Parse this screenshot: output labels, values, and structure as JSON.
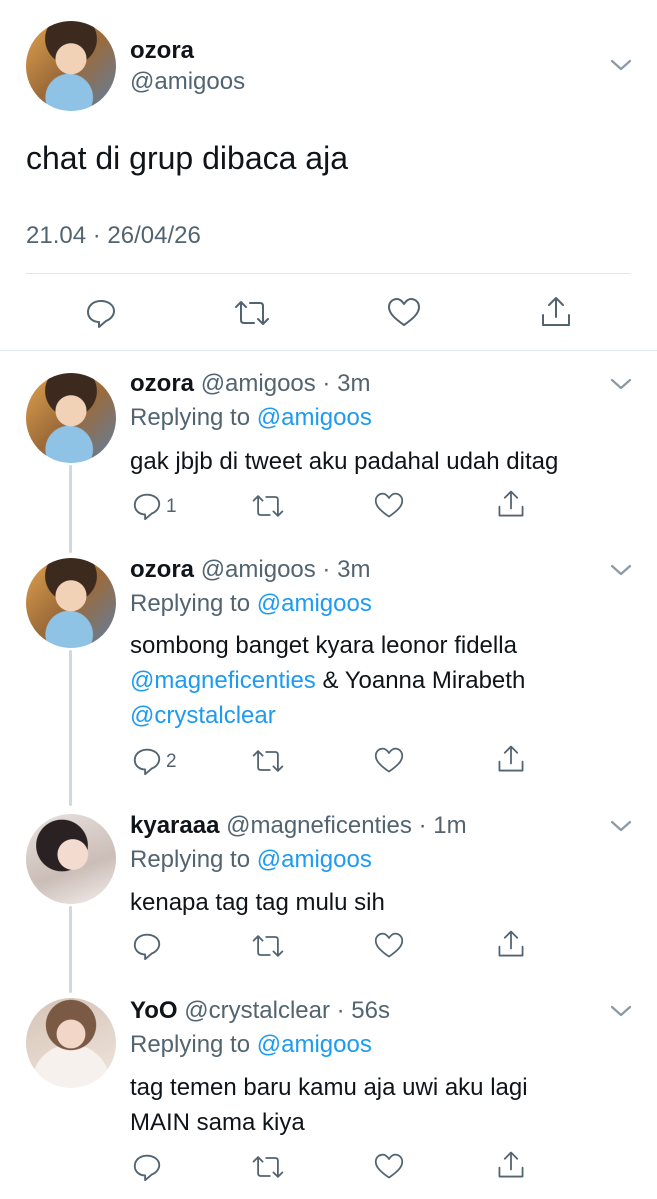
{
  "main_tweet": {
    "display_name": "ozora",
    "handle": "@amigoos",
    "text": "chat di grup dibaca aja",
    "timestamp": "21.04 · 26/04/26"
  },
  "replies": [
    {
      "display_name": "ozora",
      "meta": "@amigoos · 3m",
      "replying_prefix": "Replying to",
      "replying_handle": "@amigoos",
      "lines": [
        "gak jbjb di tweet aku padahal udah ditag"
      ],
      "reply_count": "1"
    },
    {
      "display_name": "ozora",
      "meta": "@amigoos · 3m",
      "replying_prefix": "Replying to",
      "replying_handle": "@amigoos",
      "line1": "sombong banget kyara leonor fidella",
      "mention1": "@magneficenties",
      "line2_rest": " & Yoanna Mirabeth",
      "mention2": "@crystalclear",
      "reply_count": "2"
    },
    {
      "display_name": "kyaraaa",
      "meta": "@magneficenties · 1m",
      "replying_prefix": "Replying to",
      "replying_handle": "@amigoos",
      "lines": [
        "kenapa tag tag mulu sih"
      ]
    },
    {
      "display_name": "YoO",
      "meta": "@crystalclear · 56s",
      "replying_prefix": "Replying to",
      "replying_handle": "@amigoos",
      "lines": [
        "tag temen baru kamu aja uwi aku lagi",
        "MAIN sama kiya"
      ]
    }
  ],
  "icons": [
    "reply-icon",
    "retweet-icon",
    "like-icon",
    "share-icon",
    "chevron-down-icon"
  ],
  "colors": {
    "link": "#1d9bf0",
    "secondary": "#536471",
    "divider": "#e1e8ed"
  }
}
